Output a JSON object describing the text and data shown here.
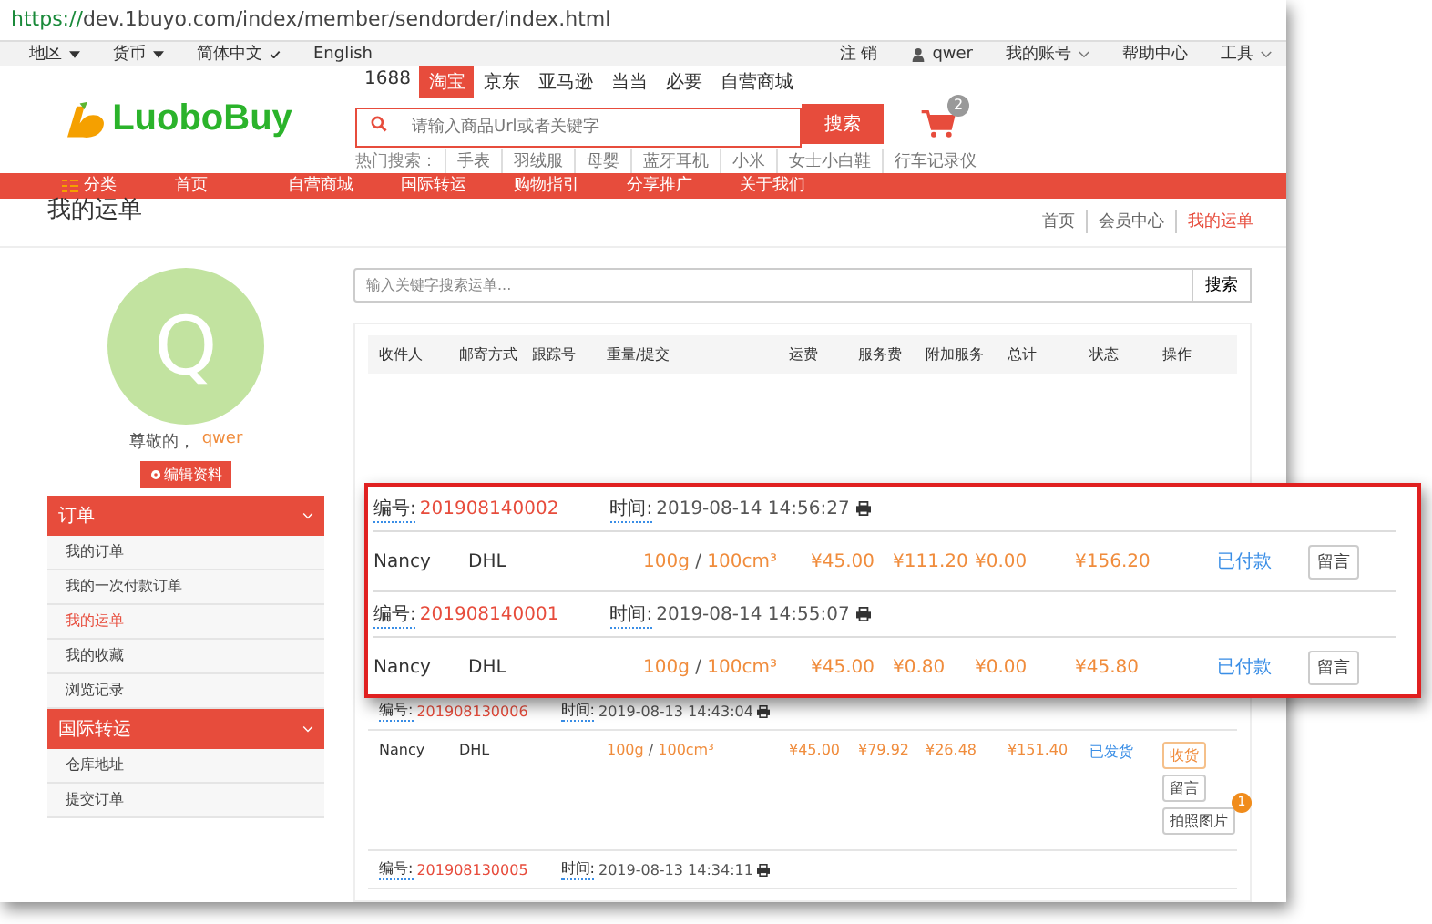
{
  "browser": {
    "scheme": "https://",
    "address": "dev.1buyo.com/index/member/sendorder/index.html"
  },
  "topbar": {
    "left": [
      {
        "label": "地区",
        "kind": "dropdown"
      },
      {
        "label": "货币",
        "kind": "dropdown"
      },
      {
        "label": "简体中文",
        "kind": "check"
      },
      {
        "label": "English",
        "kind": "plain"
      }
    ],
    "right": [
      {
        "label": "注 销",
        "kind": "plain"
      },
      {
        "label": "qwer",
        "kind": "user"
      },
      {
        "label": "我的账号",
        "kind": "dropdown"
      },
      {
        "label": "帮助中心",
        "kind": "plain"
      },
      {
        "label": "工具",
        "kind": "dropdown"
      }
    ]
  },
  "logo": {
    "text": "LuoboBuy"
  },
  "search": {
    "tabs": [
      {
        "label": "1688",
        "selected": false
      },
      {
        "label": "淘宝",
        "selected": true
      },
      {
        "label": "京东",
        "selected": false
      },
      {
        "label": "亚马逊",
        "selected": false
      },
      {
        "label": "当当",
        "selected": false
      },
      {
        "label": "必要",
        "selected": false
      },
      {
        "label": "自营商城",
        "selected": false
      }
    ],
    "placeholder": "请输入商品Url或者关键字",
    "button": "搜索",
    "hot_label": "热门搜索：",
    "hot": [
      "手表",
      "羽绒服",
      "母婴",
      "蓝牙耳机",
      "小米",
      "女士小白鞋",
      "行车记录仪"
    ],
    "cart_count": "2"
  },
  "nav": [
    {
      "label": "分类",
      "kind": "category"
    },
    {
      "label": "首页",
      "kind": "link"
    },
    {
      "label": "自营商城",
      "kind": "link"
    },
    {
      "label": "国际转运",
      "kind": "link"
    },
    {
      "label": "购物指引",
      "kind": "link"
    },
    {
      "label": "分享推广",
      "kind": "link"
    },
    {
      "label": "关于我们",
      "kind": "link"
    }
  ],
  "page_title": "我的运单",
  "breadcrumb": [
    {
      "label": "首页",
      "selected": false
    },
    {
      "label": "会员中心",
      "selected": false
    },
    {
      "label": "我的运单",
      "selected": true
    }
  ],
  "sidebar": {
    "avatar_letter": "Q",
    "greeting": "尊敬的，",
    "username": "qwer",
    "edit_button": "编辑资料",
    "sections": [
      {
        "title": "订单",
        "expanded": true,
        "items": [
          {
            "label": "我的订单",
            "selected": false
          },
          {
            "label": "我的一次付款订单",
            "selected": false
          },
          {
            "label": "我的运单",
            "selected": true
          },
          {
            "label": "我的收藏",
            "selected": false
          },
          {
            "label": "浏览记录",
            "selected": false
          }
        ]
      },
      {
        "title": "国际转运",
        "expanded": true,
        "items": [
          {
            "label": "仓库地址",
            "selected": false
          },
          {
            "label": "提交订单",
            "selected": false
          }
        ]
      }
    ]
  },
  "main": {
    "search_placeholder": "输入关键字搜索运单...",
    "search_button": "搜索",
    "columns": [
      "收件人",
      "邮寄方式",
      "跟踪号",
      "重量/提交",
      "运费",
      "服务费",
      "附加服务",
      "总计",
      "状态",
      "操作"
    ],
    "orders": [
      {
        "no_label": "编号:",
        "no": "201908130006",
        "time_label": "时间:",
        "time": "2019-08-13 14:43:04",
        "recipient": "Nancy",
        "carrier": "DHL",
        "weight": "100g",
        "sep": "/",
        "volume": "100cm³",
        "fee": "¥45.00",
        "service": "¥79.92",
        "extra": "¥26.48",
        "total": "¥151.40",
        "status": "已发货",
        "actions": [
          {
            "label": "收货",
            "kind": "accent"
          },
          {
            "label": "留言",
            "kind": "plain"
          },
          {
            "label": "拍照图片",
            "kind": "plain",
            "badge": "1"
          }
        ]
      },
      {
        "no_label": "编号:",
        "no": "201908130005",
        "time_label": "时间:",
        "time": "2019-08-13 14:34:11"
      }
    ]
  },
  "callout": {
    "orders": [
      {
        "no_label": "编号:",
        "no": "201908140002",
        "time_label": "时间:",
        "time": "2019-08-14 14:56:27",
        "recipient": "Nancy",
        "carrier": "DHL",
        "weight": "100g",
        "sep": "/",
        "volume": "100cm³",
        "fee": "¥45.00",
        "service": "¥111.20",
        "extra": "¥0.00",
        "total": "¥156.20",
        "status": "已付款",
        "actions": [
          {
            "label": "留言",
            "kind": "plain"
          }
        ]
      },
      {
        "no_label": "编号:",
        "no": "201908140001",
        "time_label": "时间:",
        "time": "2019-08-14 14:55:07",
        "recipient": "Nancy",
        "carrier": "DHL",
        "weight": "100g",
        "sep": "/",
        "volume": "100cm³",
        "fee": "¥45.00",
        "service": "¥0.80",
        "extra": "¥0.00",
        "total": "¥45.80",
        "status": "已付款",
        "actions": [
          {
            "label": "留言",
            "kind": "plain"
          }
        ]
      }
    ]
  }
}
